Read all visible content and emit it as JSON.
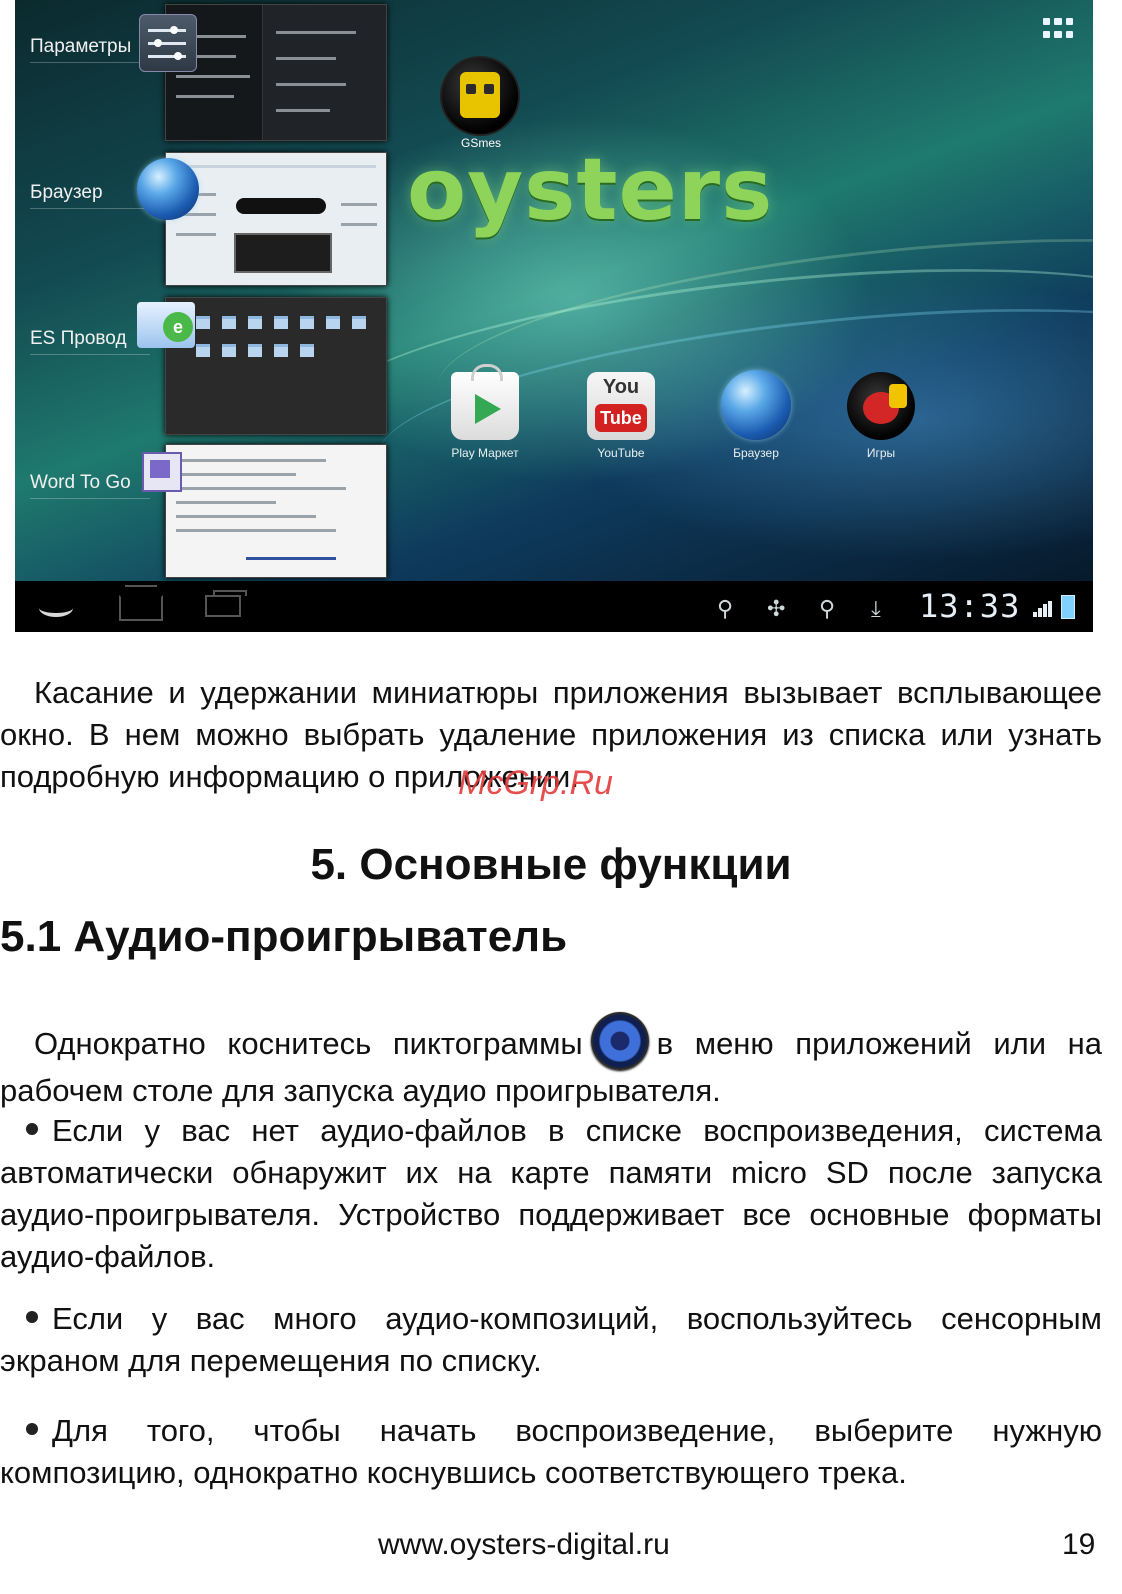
{
  "screenshot": {
    "recent_apps": [
      {
        "label": "Параметры"
      },
      {
        "label": "Браузер"
      },
      {
        "label": "ES Провод"
      },
      {
        "label": "Word To Go"
      }
    ],
    "brand_logo": "oysters",
    "gsmes_label": "GSmes",
    "dock": [
      {
        "label": "Play Маркет",
        "icon": "play-store-icon"
      },
      {
        "label": "YouTube",
        "icon": "youtube-icon",
        "logo_top": "You",
        "logo_bottom": "Tube"
      },
      {
        "label": "Браузер",
        "icon": "browser-globe-icon"
      },
      {
        "label": "Игры",
        "icon": "angry-birds-icon"
      }
    ],
    "clock": "13:33",
    "colors": {
      "logo": "#8ed35a",
      "battery": "#7fd2ff"
    }
  },
  "text": {
    "para1": "Касание и удержании миниатюры приложения вызывает всплывающее окно. В нем можно выбрать удаление приложения из списка или узнать подробную информацию о приложении.",
    "watermark": "McGrp.Ru",
    "section_title": "5. Основные функции",
    "subsection_title": "5.1 Аудио-проигрыватель",
    "para2_before": "Однократно коснитесь пиктограммы",
    "para2_after": "в меню приложений или на рабочем столе для запуска аудио проигрывателя.",
    "bullets": [
      "Если у вас нет аудио-файлов в списке воспроизведения, система автоматически обнаружит их на карте памяти micro SD после запуска аудио-проигрывателя. Устройство поддерживает все основные форматы аудио-файлов.",
      "Если у вас много аудио-композиций, воспользуйтесь сенсорным экраном для перемещения по списку.",
      "Для того, чтобы начать воспроизведение, выберите нужную композицию, однократно коснувшись соответствующего трека."
    ]
  },
  "footer": {
    "url": "www.oysters-digital.ru",
    "page_number": "19"
  }
}
